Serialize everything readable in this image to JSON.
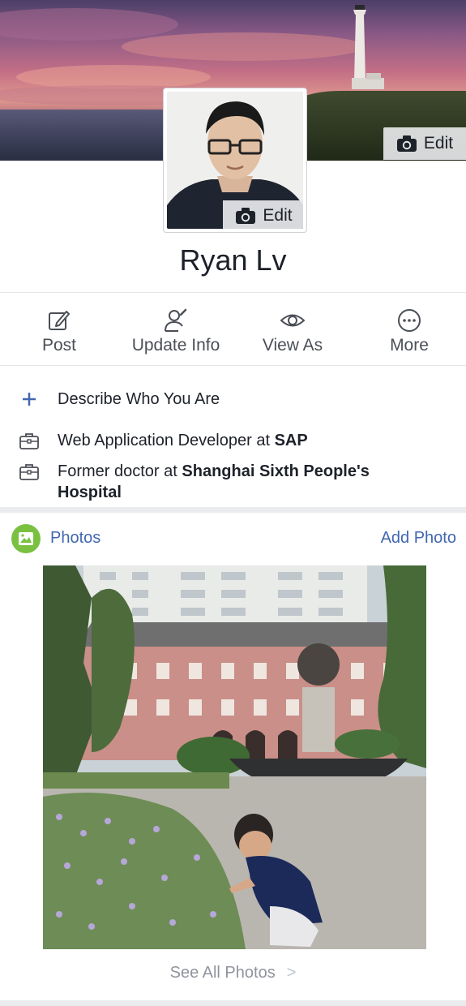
{
  "cover": {
    "edit_label": "Edit",
    "edit_icon": "camera-icon"
  },
  "profile": {
    "name": "Ryan Lv",
    "edit_label": "Edit",
    "edit_icon": "camera-icon"
  },
  "actions": [
    {
      "label": "Post",
      "icon": "pencil-square-icon"
    },
    {
      "label": "Update Info",
      "icon": "person-edit-icon"
    },
    {
      "label": "View As",
      "icon": "eye-icon"
    },
    {
      "label": "More",
      "icon": "ellipsis-circle-icon"
    }
  ],
  "intro": {
    "describe_label": "Describe Who You Are",
    "work": [
      {
        "prefix": "Web Application Developer at ",
        "org": "SAP"
      },
      {
        "prefix": "Former doctor at ",
        "org": "Shanghai Sixth People's Hospital"
      }
    ]
  },
  "photos": {
    "title": "Photos",
    "add_label": "Add Photo",
    "see_all_label": "See All Photos",
    "see_all_chevron": ">"
  },
  "colors": {
    "link": "#4267b2",
    "photos_badge": "#7ac142",
    "muted": "#90949c"
  }
}
